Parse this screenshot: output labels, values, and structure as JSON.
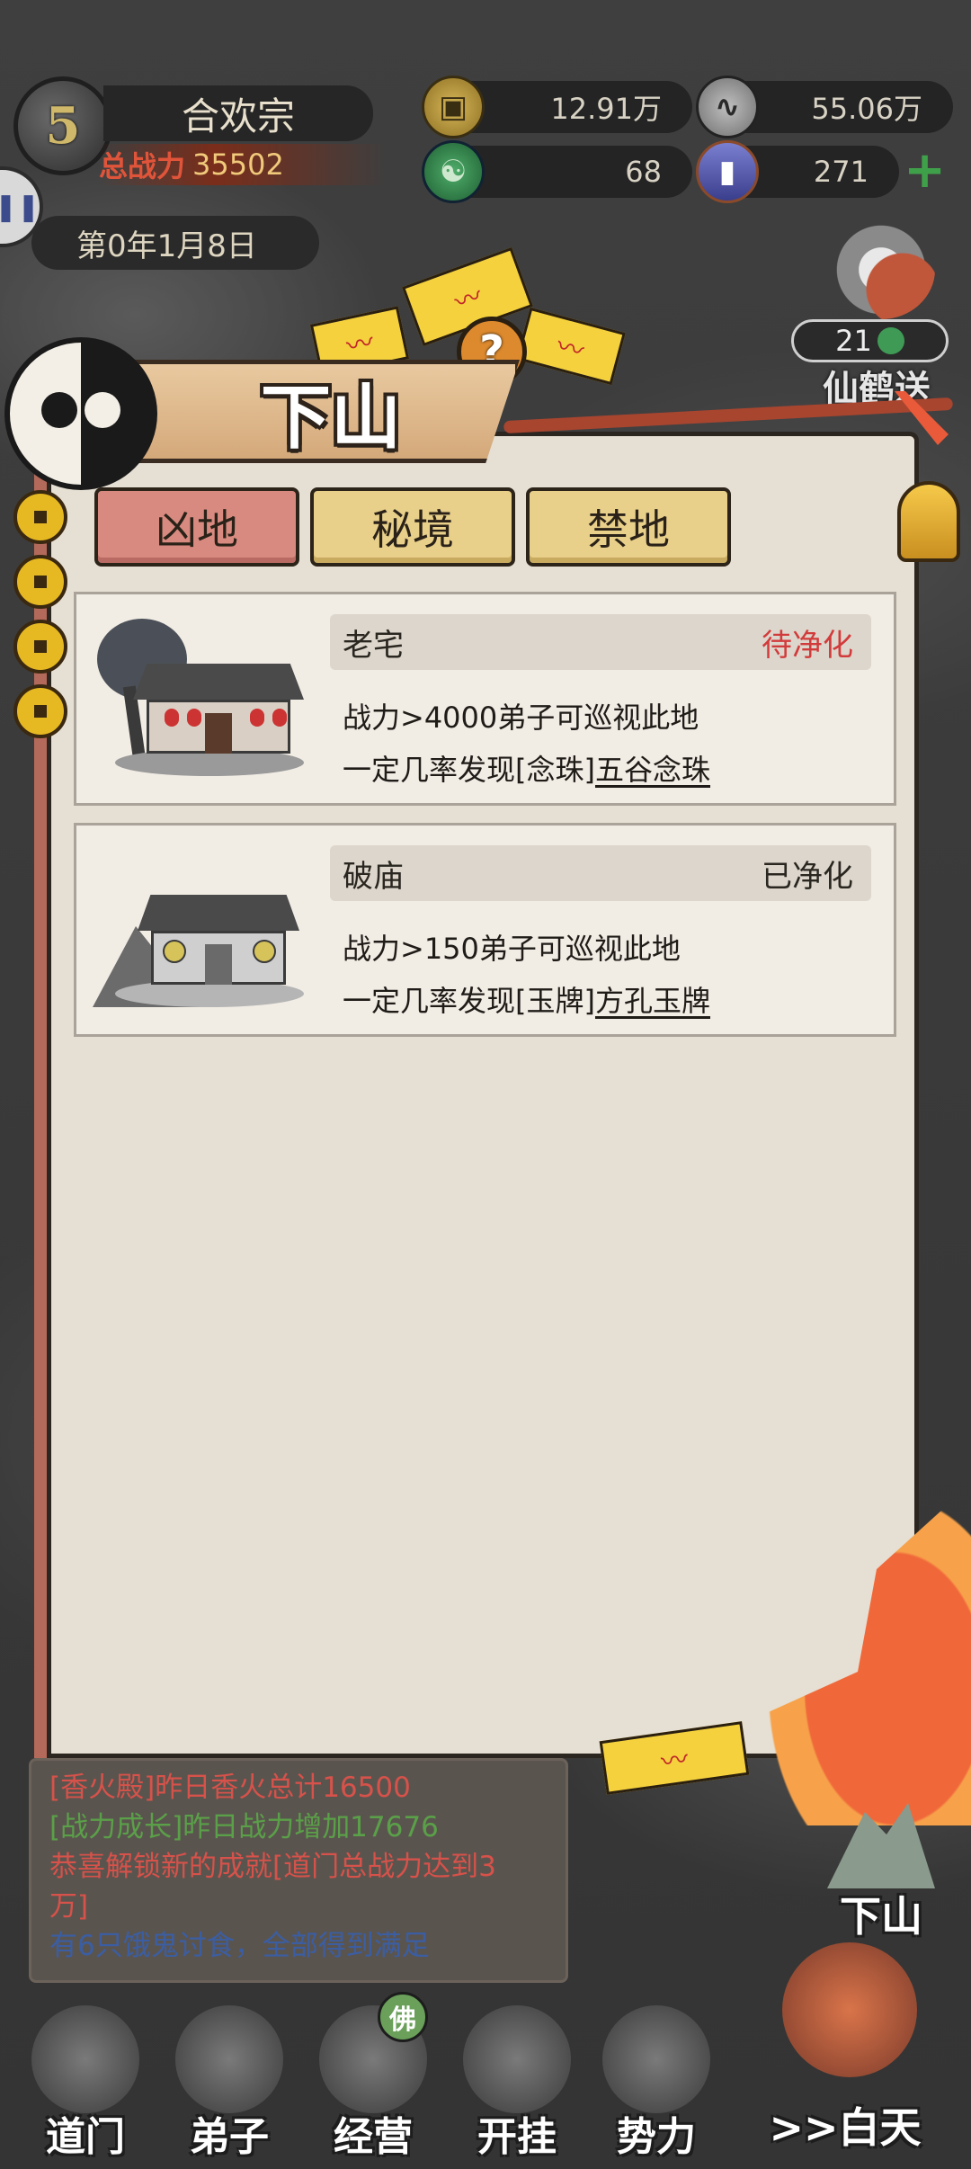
{
  "hud": {
    "level": "5",
    "sect_name": "合欢宗",
    "power_label": "总战力",
    "power_value": "35502",
    "date": "第0年1月8日"
  },
  "resources": {
    "coins": "12.91万",
    "incense": "55.06万",
    "jade": "68",
    "tokens": "271"
  },
  "crane": {
    "count": "21",
    "label": "仙鹤送"
  },
  "panel": {
    "title": "下山",
    "tabs": [
      {
        "label": "凶地",
        "active": true
      },
      {
        "label": "秘境",
        "active": false
      },
      {
        "label": "禁地",
        "active": false
      }
    ],
    "locations": [
      {
        "name": "老宅",
        "status": "待净化",
        "requirement": "战力>4000弟子可巡视此地",
        "drop_prefix": "一定几率发现[念珠]",
        "drop_item": "五谷念珠"
      },
      {
        "name": "破庙",
        "status": "已净化",
        "requirement": "战力>150弟子可巡视此地",
        "drop_prefix": "一定几率发现[玉牌]",
        "drop_item": "方孔玉牌"
      }
    ]
  },
  "log": {
    "line1": "[香火殿]昨日香火总计16500",
    "line2": "[战力成长]昨日战力增加17676",
    "line3a": "恭喜解锁新的成就[道门总战力达到3",
    "line3b": "万]",
    "line4": "有6只饿鬼讨食，全部得到满足"
  },
  "downhill_label": "下山",
  "nav": {
    "items": [
      "道门",
      "弟子",
      "经营",
      "开挂",
      "势力"
    ],
    "badge": "佛",
    "day_label": ">>白天"
  }
}
